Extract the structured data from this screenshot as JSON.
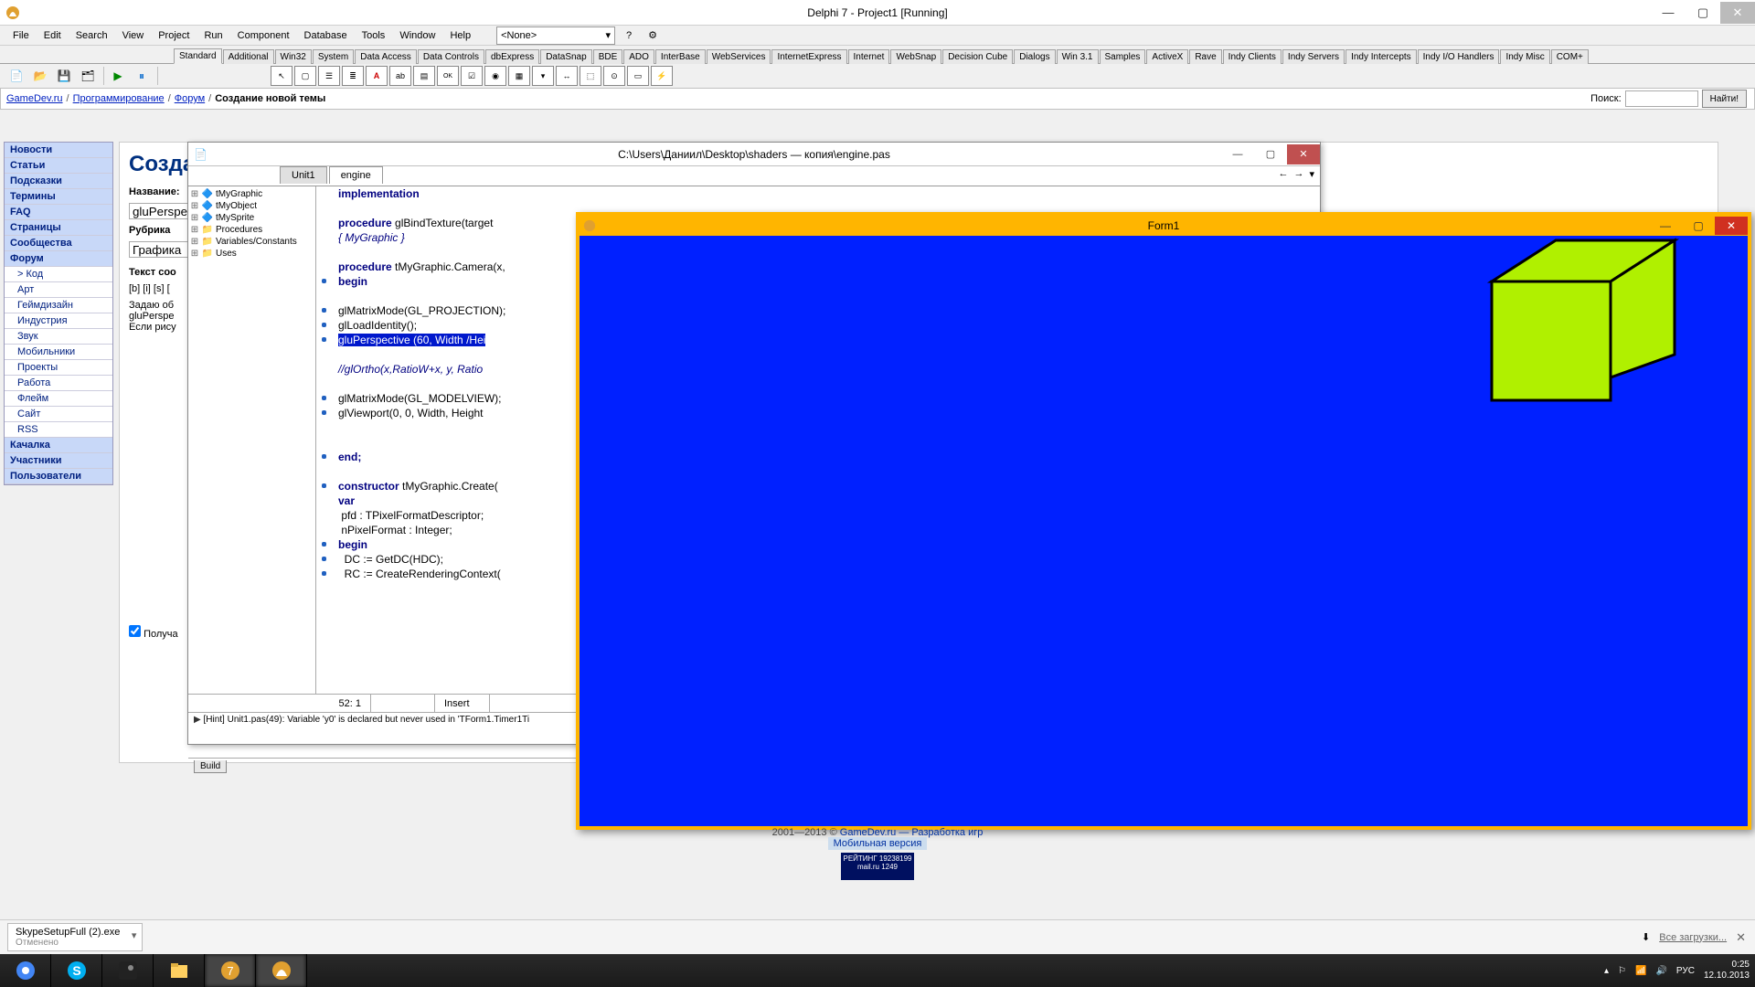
{
  "title": "Delphi 7 - Project1 [Running]",
  "menus": [
    "File",
    "Edit",
    "Search",
    "View",
    "Project",
    "Run",
    "Component",
    "Database",
    "Tools",
    "Window",
    "Help"
  ],
  "dropdown": "<None>",
  "palette_tabs": [
    "Standard",
    "Additional",
    "Win32",
    "System",
    "Data Access",
    "Data Controls",
    "dbExpress",
    "DataSnap",
    "BDE",
    "ADO",
    "InterBase",
    "WebServices",
    "InternetExpress",
    "Internet",
    "WebSnap",
    "Decision Cube",
    "Dialogs",
    "Win 3.1",
    "Samples",
    "ActiveX",
    "Rave",
    "Indy Clients",
    "Indy Servers",
    "Indy Intercepts",
    "Indy I/O Handlers",
    "Indy Misc",
    "COM+"
  ],
  "breadcrumb": {
    "links": [
      "GameDev.ru",
      "Программирование",
      "Форум"
    ],
    "current": "Создание новой темы",
    "search_label": "Поиск:",
    "search_button": "Найти!"
  },
  "sidenav": {
    "sections": [
      {
        "type": "header",
        "label": "Новости"
      },
      {
        "type": "header",
        "label": "Статьи"
      },
      {
        "type": "header",
        "label": "Подсказки"
      },
      {
        "type": "header",
        "label": "Термины"
      },
      {
        "type": "header",
        "label": "FAQ"
      },
      {
        "type": "header",
        "label": "Страницы"
      },
      {
        "type": "header",
        "label": "Сообщества"
      },
      {
        "type": "header",
        "label": "Форум"
      },
      {
        "type": "sub",
        "label": "> Код"
      },
      {
        "type": "sub",
        "label": "Арт"
      },
      {
        "type": "sub",
        "label": "Геймдизайн"
      },
      {
        "type": "sub",
        "label": "Индустрия"
      },
      {
        "type": "sub",
        "label": "Звук"
      },
      {
        "type": "sub",
        "label": "Мобильники"
      },
      {
        "type": "sub",
        "label": "Проекты"
      },
      {
        "type": "sub",
        "label": "Работа"
      },
      {
        "type": "sub",
        "label": "Флейм"
      },
      {
        "type": "sub",
        "label": "Сайт"
      },
      {
        "type": "sub",
        "label": "RSS"
      },
      {
        "type": "header",
        "label": "Качалка"
      },
      {
        "type": "header",
        "label": "Участники"
      },
      {
        "type": "header",
        "label": "Пользователи"
      }
    ]
  },
  "formpanel": {
    "title": "Созда",
    "name_label": "Название:",
    "name_value": "gluPerspe",
    "rubric_label": "Рубрика",
    "rubric_value": "Графика",
    "body_label": "Текст соо",
    "toolbar": "[b] [i] [s] [",
    "bodytext": "Задаю об\ngluPerspe\nЕсли рису",
    "checkbox_label": "Получа"
  },
  "editor": {
    "title_path": "C:\\Users\\Даниил\\Desktop\\shaders — копия\\engine.pas",
    "tabs": [
      "Unit1",
      "engine"
    ],
    "active_tab": "engine",
    "tree": [
      "tMyGraphic",
      "tMyObject",
      "tMySprite",
      "Procedures",
      "Variables/Constants",
      "Uses"
    ],
    "status_pos": "52:  1",
    "status_mode": "Insert",
    "hint_text": "[Hint] Unit1.pas(49): Variable 'y0' is declared but never used in 'TForm1.Timer1Ti",
    "build_tab": "Build",
    "code": {
      "l1": "implementation",
      "l2": "",
      "l3p": "procedure",
      "l3t": " glBindTexture(target",
      "l4": "{ MyGraphic }",
      "l5": "",
      "l6p": "procedure",
      "l6t": " tMyGraphic.Camera(x,",
      "l7": "begin",
      "l8": "",
      "l9": "glMatrixMode(GL_PROJECTION);",
      "l10": "glLoadIdentity();",
      "l11": "gluPerspective (60, Width /Hei",
      "l12": "",
      "l13": "//glOrtho(x,RatioW+x, y, Ratio",
      "l14": "",
      "l15": "glMatrixMode(GL_MODELVIEW);",
      "l16": "glViewport(0, 0, Width, Height",
      "l17": "",
      "l18": "",
      "l19": "end;",
      "l20": "",
      "l21p": "constructor",
      "l21t": " tMyGraphic.Create(",
      "l22": "var",
      "l23": " pfd : TPixelFormatDescriptor;",
      "l24": " nPixelFormat : Integer;",
      "l25": "begin",
      "l26": "  DC := GetDC(HDC);",
      "l27": "  RC := CreateRenderingContext("
    }
  },
  "form1": {
    "title": "Form1"
  },
  "footer": {
    "copy": "2001—2013 © ",
    "link": "GameDev.ru — Разработка игр",
    "mobile": "Мобильная версия",
    "rating1": "РЕЙТИНГ 19238199",
    "rating2": "mail.ru       1249"
  },
  "download": {
    "file": "SkypeSetupFull (2).exe",
    "status": "Отменено",
    "all": "Все загрузки..."
  },
  "tray": {
    "lang": "РУС",
    "time": "0:25",
    "date": "12.10.2013"
  }
}
